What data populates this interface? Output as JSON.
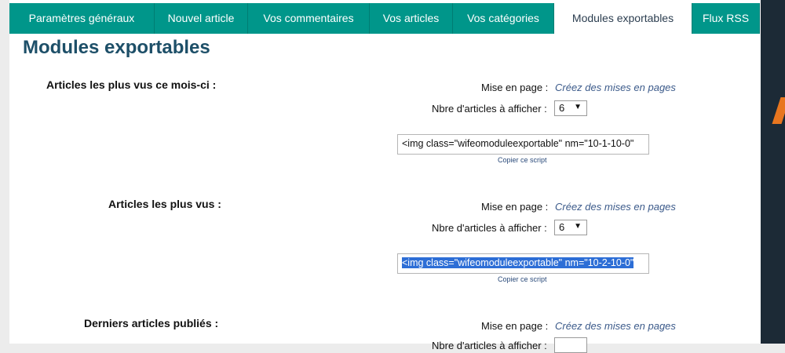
{
  "tabs": [
    {
      "label": "Paramètres généraux",
      "active": false
    },
    {
      "label": "Nouvel article",
      "active": false
    },
    {
      "label": "Vos commentaires",
      "active": false
    },
    {
      "label": "Vos articles",
      "active": false
    },
    {
      "label": "Vos catégories",
      "active": false
    },
    {
      "label": "Modules exportables",
      "active": true
    },
    {
      "label": "Flux RSS",
      "active": false
    }
  ],
  "page_title": "Modules exportables",
  "modules": [
    {
      "title": "Articles les plus vus ce mois-ci :",
      "layout_label": "Mise en page :",
      "layout_link": "Créez des mises en pages",
      "count_label": "Nbre d'articles à afficher :",
      "count_value": "6",
      "script": "<img class=\"wifeomoduleexportable\" nm=\"10-1-10-0\"",
      "copy_label": "Copier ce script"
    },
    {
      "title": "Articles les plus vus :",
      "layout_label": "Mise en page :",
      "layout_link": "Créez des mises en pages",
      "count_label": "Nbre d'articles à afficher :",
      "count_value": "6",
      "script": "<img class=\"wifeomoduleexportable\" nm=\"10-2-10-0\"",
      "copy_label": "Copier ce script"
    },
    {
      "title": "Derniers articles publiés :",
      "layout_label": "Mise en page :",
      "layout_link": "Créez des mises en pages",
      "count_label": "Nbre d'articles à afficher :"
    }
  ],
  "colors": {
    "tab_bg": "#00968a",
    "title": "#1d4f68",
    "link": "#3b5a8a",
    "selection": "#2d6ed6"
  }
}
